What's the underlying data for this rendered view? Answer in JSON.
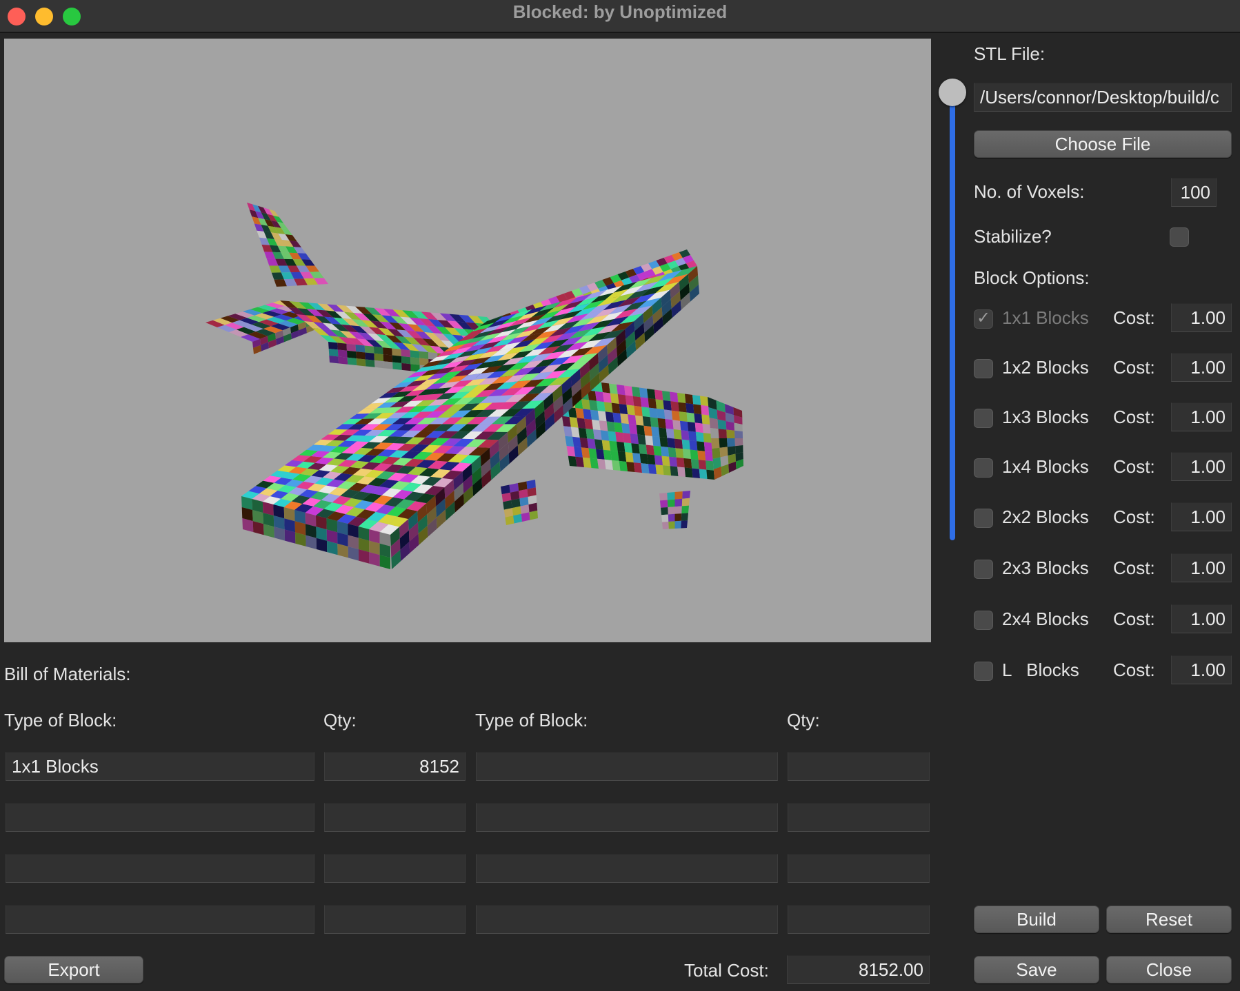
{
  "window": {
    "title": "Blocked: by Unoptimized"
  },
  "colors": {
    "close": "#fe5f57",
    "minimize": "#febc2e",
    "zoom": "#28c840",
    "slider_accent": "#2f6ee6",
    "viewport_bg": "#a3a3a3"
  },
  "settings": {
    "stl_label": "STL File:",
    "stl_path": "/Users/connor/Desktop/build/c",
    "choose_file": "Choose File",
    "voxels_label": "No. of Voxels:",
    "voxels_value": "100",
    "stabilize_label": "Stabilize?",
    "stabilize_checked": false,
    "block_options_label": "Block Options:",
    "cost_label": "Cost:",
    "blocks": [
      {
        "name": "1x1 Blocks",
        "checked": true,
        "disabled": true,
        "cost": "1.00"
      },
      {
        "name": "1x2 Blocks",
        "checked": false,
        "disabled": false,
        "cost": "1.00"
      },
      {
        "name": "1x3 Blocks",
        "checked": false,
        "disabled": false,
        "cost": "1.00"
      },
      {
        "name": "1x4 Blocks",
        "checked": false,
        "disabled": false,
        "cost": "1.00"
      },
      {
        "name": "2x2 Blocks",
        "checked": false,
        "disabled": false,
        "cost": "1.00"
      },
      {
        "name": "2x3 Blocks",
        "checked": false,
        "disabled": false,
        "cost": "1.00"
      },
      {
        "name": "2x4 Blocks",
        "checked": false,
        "disabled": false,
        "cost": "1.00"
      },
      {
        "name": "L   Blocks",
        "checked": false,
        "disabled": false,
        "cost": "1.00"
      }
    ]
  },
  "bom": {
    "label": "Bill of Materials:",
    "type_header": "Type of Block:",
    "qty_header": "Qty:",
    "rows": [
      {
        "type1": "1x1 Blocks",
        "qty1": "8152",
        "type2": "",
        "qty2": ""
      },
      {
        "type1": "",
        "qty1": "",
        "type2": "",
        "qty2": ""
      },
      {
        "type1": "",
        "qty1": "",
        "type2": "",
        "qty2": ""
      },
      {
        "type1": "",
        "qty1": "",
        "type2": "",
        "qty2": ""
      }
    ],
    "total_label": "Total Cost:",
    "total_value": "8152.00"
  },
  "buttons": {
    "export": "Export",
    "build": "Build",
    "reset": "Reset",
    "save": "Save",
    "close": "Close"
  }
}
